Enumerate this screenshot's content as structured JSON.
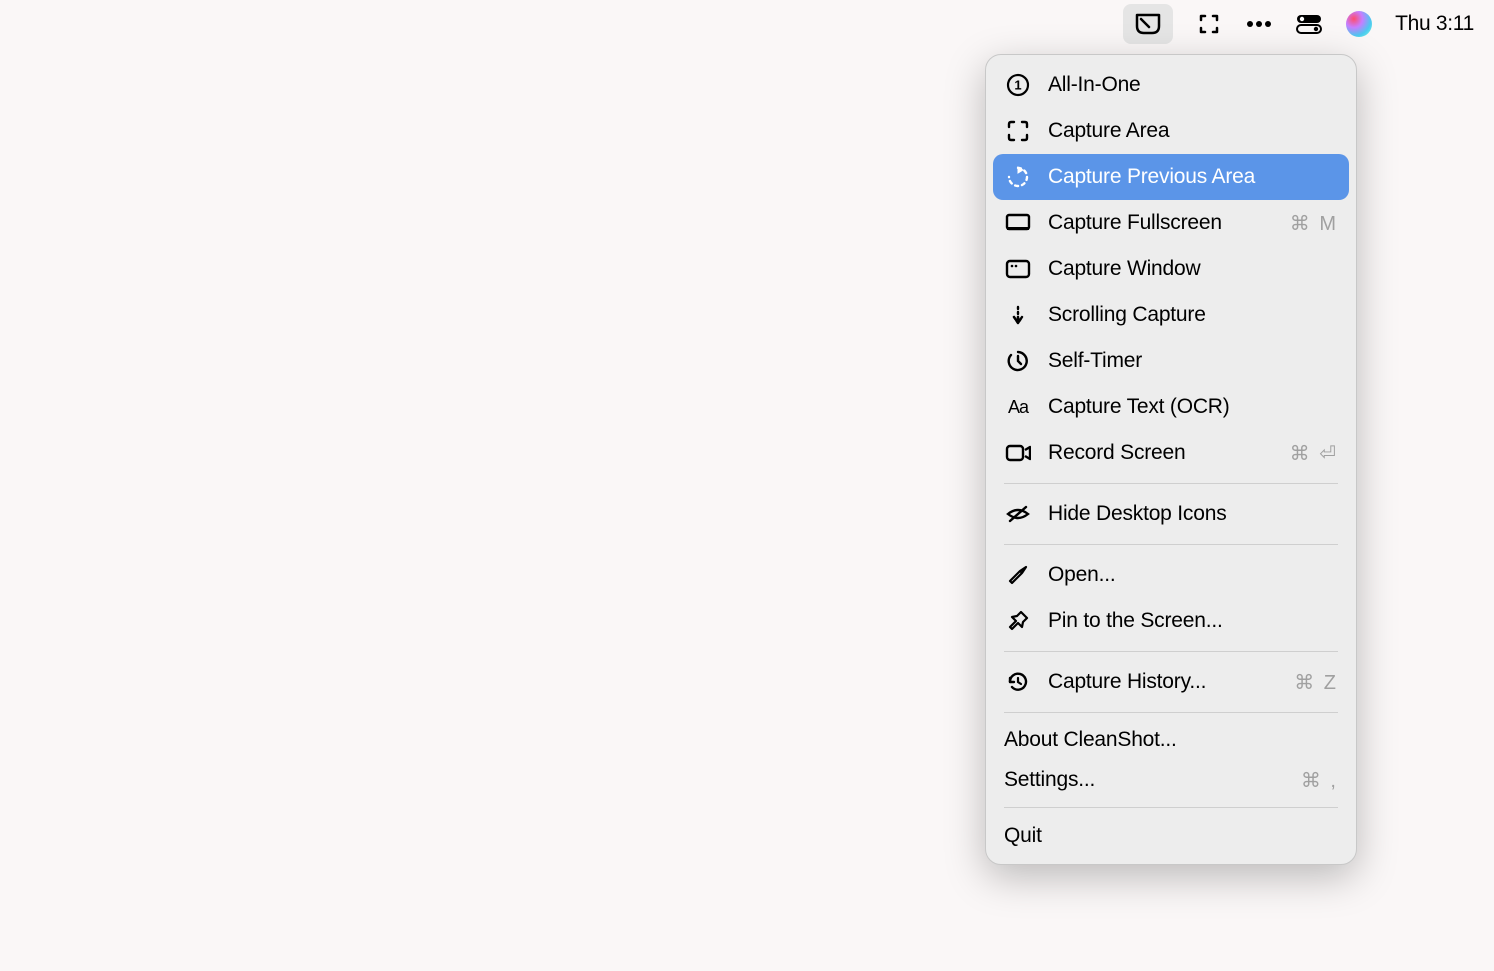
{
  "menubar": {
    "clock": "Thu 3:11"
  },
  "menu": {
    "items": [
      {
        "label": "All-In-One",
        "shortcut": ""
      },
      {
        "label": "Capture Area",
        "shortcut": ""
      },
      {
        "label": "Capture Previous Area",
        "shortcut": ""
      },
      {
        "label": "Capture Fullscreen",
        "shortcut": "⌘ M"
      },
      {
        "label": "Capture Window",
        "shortcut": ""
      },
      {
        "label": "Scrolling Capture",
        "shortcut": ""
      },
      {
        "label": "Self-Timer",
        "shortcut": ""
      },
      {
        "label": "Capture Text (OCR)",
        "shortcut": ""
      },
      {
        "label": "Record Screen",
        "shortcut": "⌘ ⏎"
      },
      {
        "label": "Hide Desktop Icons",
        "shortcut": ""
      },
      {
        "label": "Open...",
        "shortcut": ""
      },
      {
        "label": "Pin to the Screen...",
        "shortcut": ""
      },
      {
        "label": "Capture History...",
        "shortcut": "⌘ Z"
      },
      {
        "label": "About CleanShot...",
        "shortcut": ""
      },
      {
        "label": "Settings...",
        "shortcut": "⌘  ,"
      },
      {
        "label": "Quit",
        "shortcut": ""
      }
    ]
  }
}
